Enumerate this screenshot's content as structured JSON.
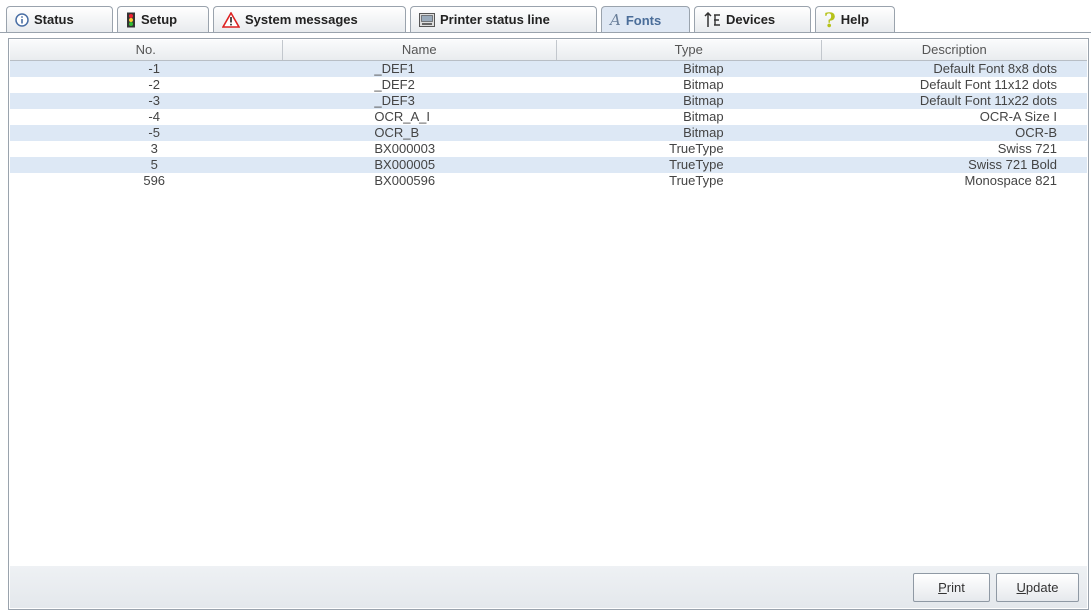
{
  "tabs": [
    {
      "label": "Status",
      "icon": "info-icon"
    },
    {
      "label": "Setup",
      "icon": "traffic-light-icon"
    },
    {
      "label": "System messages",
      "icon": "warning-icon"
    },
    {
      "label": "Printer status line",
      "icon": "display-icon"
    },
    {
      "label": "Fonts",
      "icon": "font-icon",
      "active": true
    },
    {
      "label": "Devices",
      "icon": "devices-icon"
    },
    {
      "label": "Help",
      "icon": "question-icon"
    }
  ],
  "table": {
    "columns": [
      "No.",
      "Name",
      "Type",
      "Description"
    ],
    "rows": [
      {
        "no": "-1",
        "name": "_DEF1",
        "type": "Bitmap",
        "description": "Default Font 8x8 dots"
      },
      {
        "no": "-2",
        "name": "_DEF2",
        "type": "Bitmap",
        "description": "Default Font 11x12 dots"
      },
      {
        "no": "-3",
        "name": "_DEF3",
        "type": "Bitmap",
        "description": "Default Font 11x22 dots"
      },
      {
        "no": "-4",
        "name": "OCR_A_I",
        "type": "Bitmap",
        "description": "OCR-A Size I"
      },
      {
        "no": "-5",
        "name": "OCR_B",
        "type": "Bitmap",
        "description": "OCR-B"
      },
      {
        "no": "3",
        "name": "BX000003",
        "type": "TrueType",
        "description": "Swiss 721"
      },
      {
        "no": "5",
        "name": "BX000005",
        "type": "TrueType",
        "description": "Swiss 721 Bold"
      },
      {
        "no": "596",
        "name": "BX000596",
        "type": "TrueType",
        "description": "Monospace 821"
      }
    ]
  },
  "buttons": {
    "print": {
      "mnemonic": "P",
      "rest": "rint"
    },
    "update": {
      "mnemonic": "U",
      "rest": "pdate"
    }
  },
  "colors": {
    "row_alt": "#dde8f5",
    "active_tab": "#dfe8f4",
    "border": "#9aa3ad"
  }
}
